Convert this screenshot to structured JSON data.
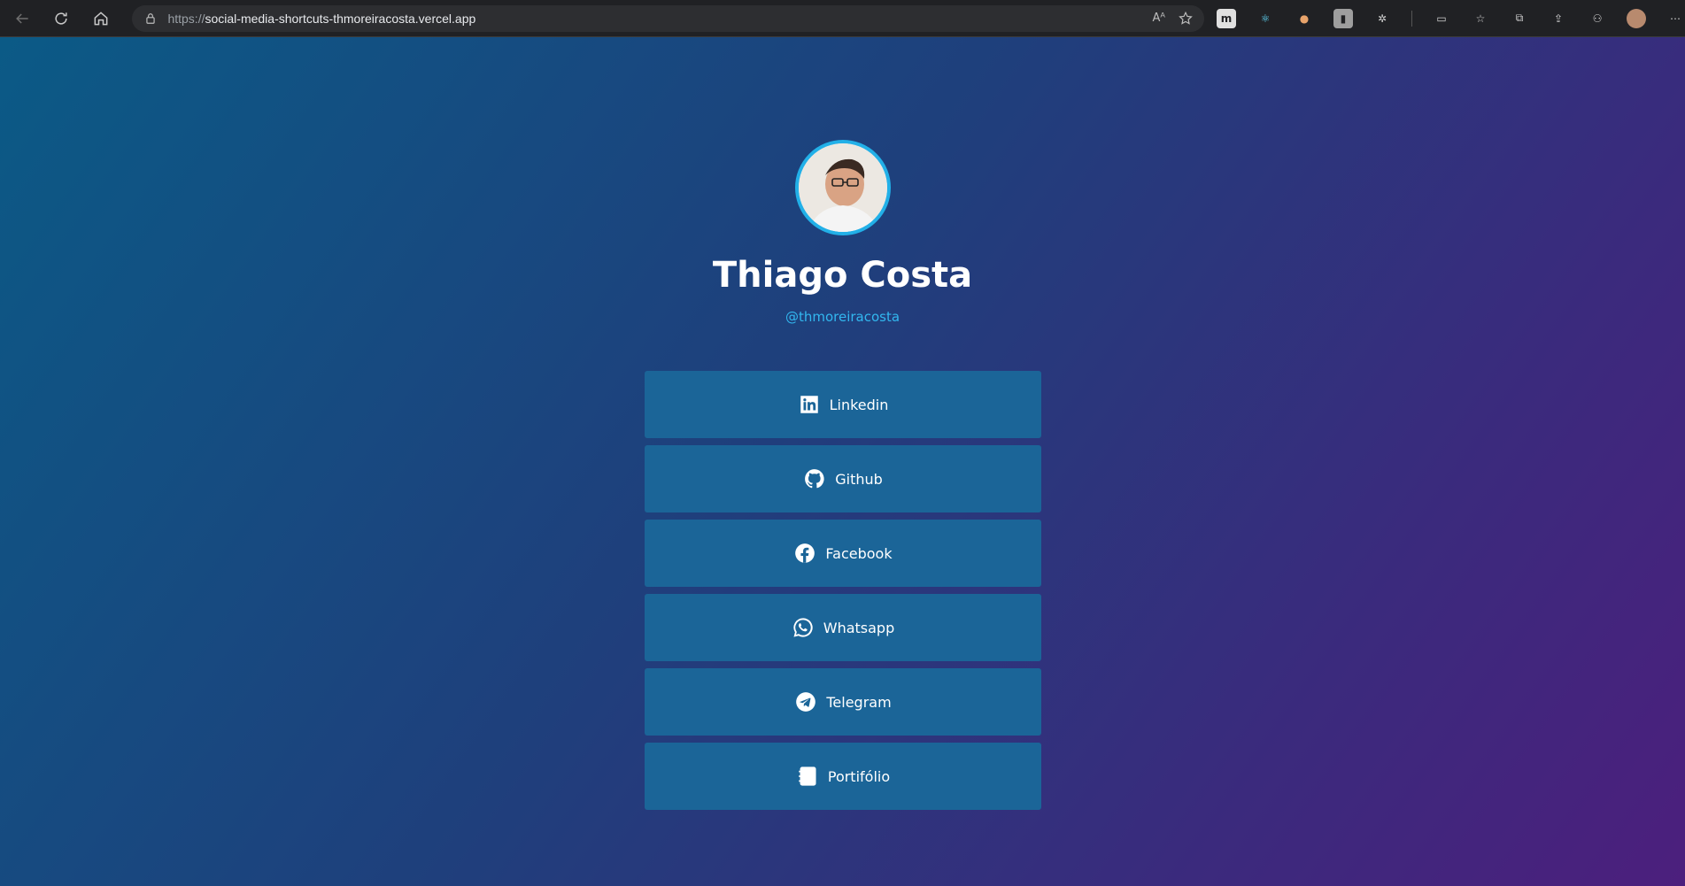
{
  "browser": {
    "url_protocol": "https://",
    "url_host": "social-media-shortcuts-thmoreiracosta.vercel.app",
    "read_aloud_label": "Aᴬ"
  },
  "profile": {
    "name": "Thiago Costa",
    "handle": "@thmoreiracosta"
  },
  "links": [
    {
      "label": "Linkedin",
      "icon": "linkedin-icon"
    },
    {
      "label": "Github",
      "icon": "github-icon"
    },
    {
      "label": "Facebook",
      "icon": "facebook-icon"
    },
    {
      "label": "Whatsapp",
      "icon": "whatsapp-icon"
    },
    {
      "label": "Telegram",
      "icon": "telegram-icon"
    },
    {
      "label": "Portifólio",
      "icon": "portfolio-icon"
    }
  ],
  "colors": {
    "accent": "#22b0e8",
    "button_bg": "#1b6598",
    "gradient_start": "#0b5a86",
    "gradient_end": "#4c1f7d"
  }
}
